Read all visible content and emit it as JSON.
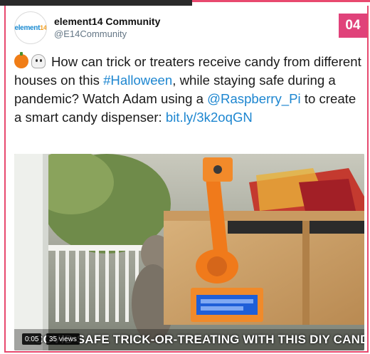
{
  "badge": "04",
  "account": {
    "avatar_text": "element",
    "avatar_suffix": "14",
    "name": "element14 Community",
    "handle": "@E14Community"
  },
  "tweet": {
    "emoji_icons": [
      "jack-o-lantern-icon",
      "ghost-icon"
    ],
    "text_1": "How can trick or treaters receive candy from different houses on this ",
    "hashtag": "#Halloween",
    "text_2": ", while staying safe during a pandemic? Watch Adam using a ",
    "mention": "@Raspberry_Pi",
    "text_3": " to create a smart candy dispenser: ",
    "link": "bit.ly/3k2oqGN"
  },
  "video": {
    "caption": "COVID SAFE TRICK-OR-TREATING WITH THIS DIY CANDY DISPENSER",
    "time": "0:05",
    "views": "35 views"
  },
  "colors": {
    "accent": "#e0427a",
    "link": "#1d86d0"
  }
}
